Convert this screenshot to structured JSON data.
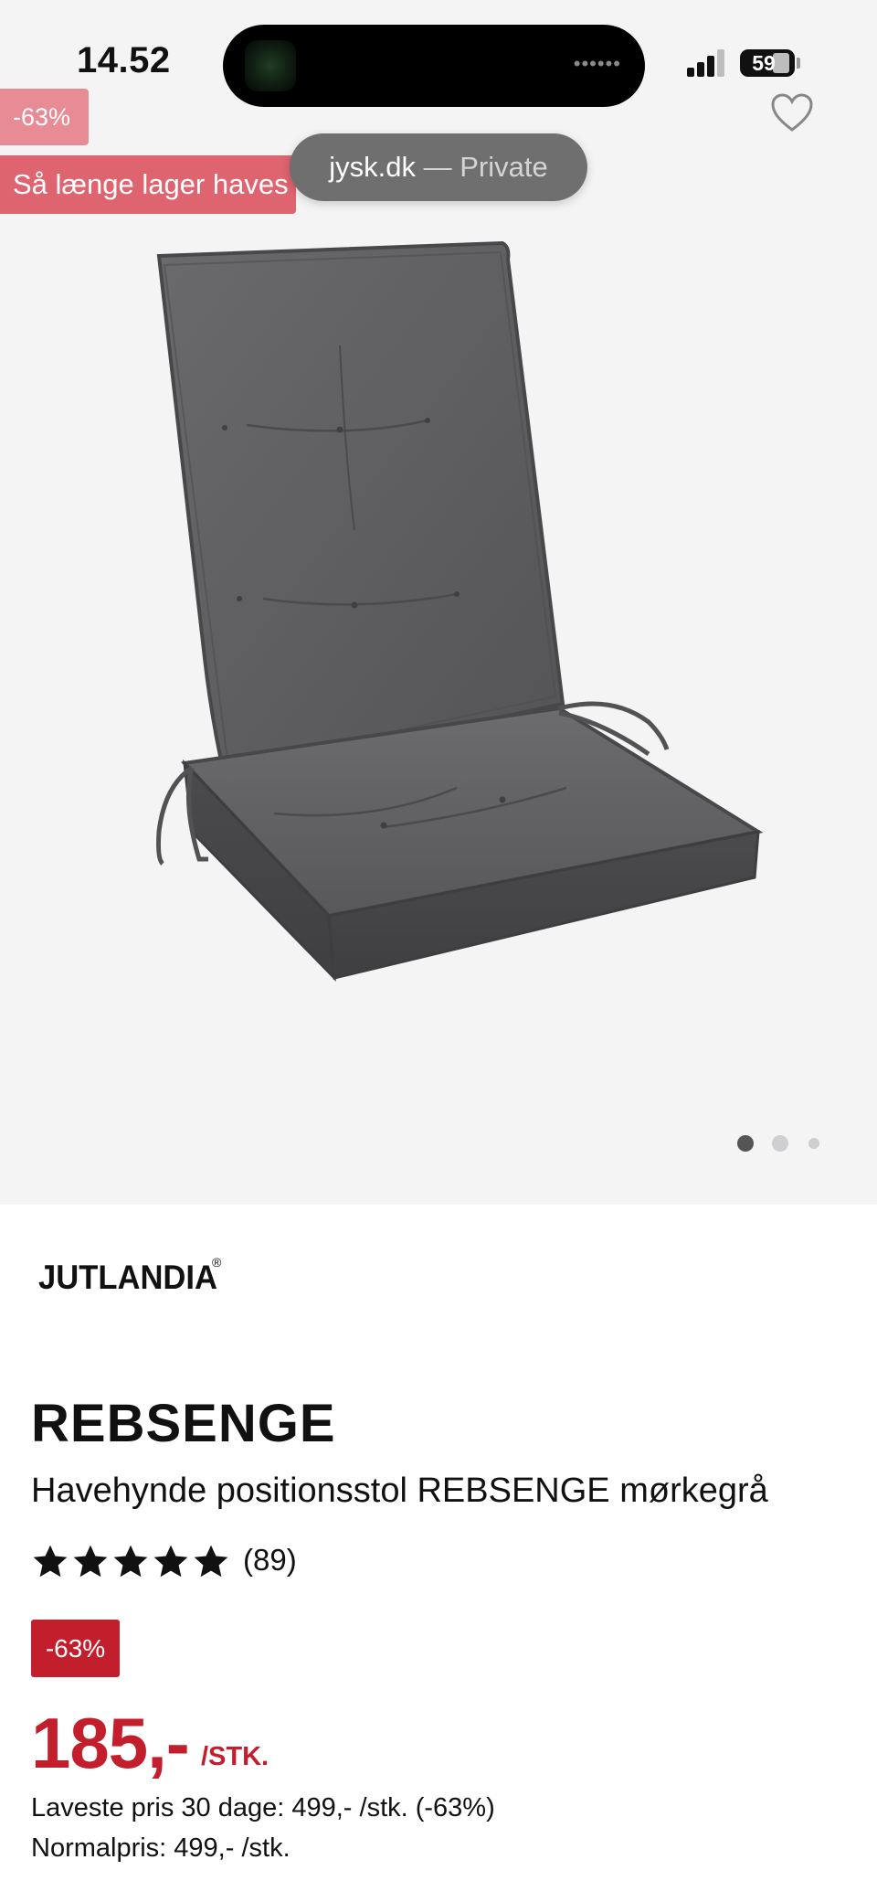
{
  "status_bar": {
    "time": "14.52",
    "battery": "59"
  },
  "browser": {
    "domain": "jysk.dk",
    "mode": "— Private"
  },
  "badges": {
    "discount": "-63%",
    "stock": "Så længe lager haves"
  },
  "icons": {
    "wishlist": "heart-outline-icon",
    "rating": "star-icon"
  },
  "gallery": {
    "image_count": 3,
    "active_index": 0
  },
  "product": {
    "brand": "JUTLANDIA",
    "brand_mark": "®",
    "title": "REBSENGE",
    "description": "Havehynde positionsstol REBSENGE mørkegrå",
    "rating_stars": 5,
    "rating_count": "(89)",
    "discount_badge": "-63%",
    "price": "185,-",
    "price_unit": "/STK.",
    "lowest_price": "Laveste pris 30 dage: 499,- /stk. (-63%)",
    "normal_price": "Normalpris: 499,- /stk."
  },
  "colors": {
    "accent_red": "#c21e2c",
    "badge_pink": "#de6470",
    "badge_light_pink": "#e98b95",
    "cushion_gray": "#5f5f61",
    "hero_background": "#f4f4f5"
  }
}
